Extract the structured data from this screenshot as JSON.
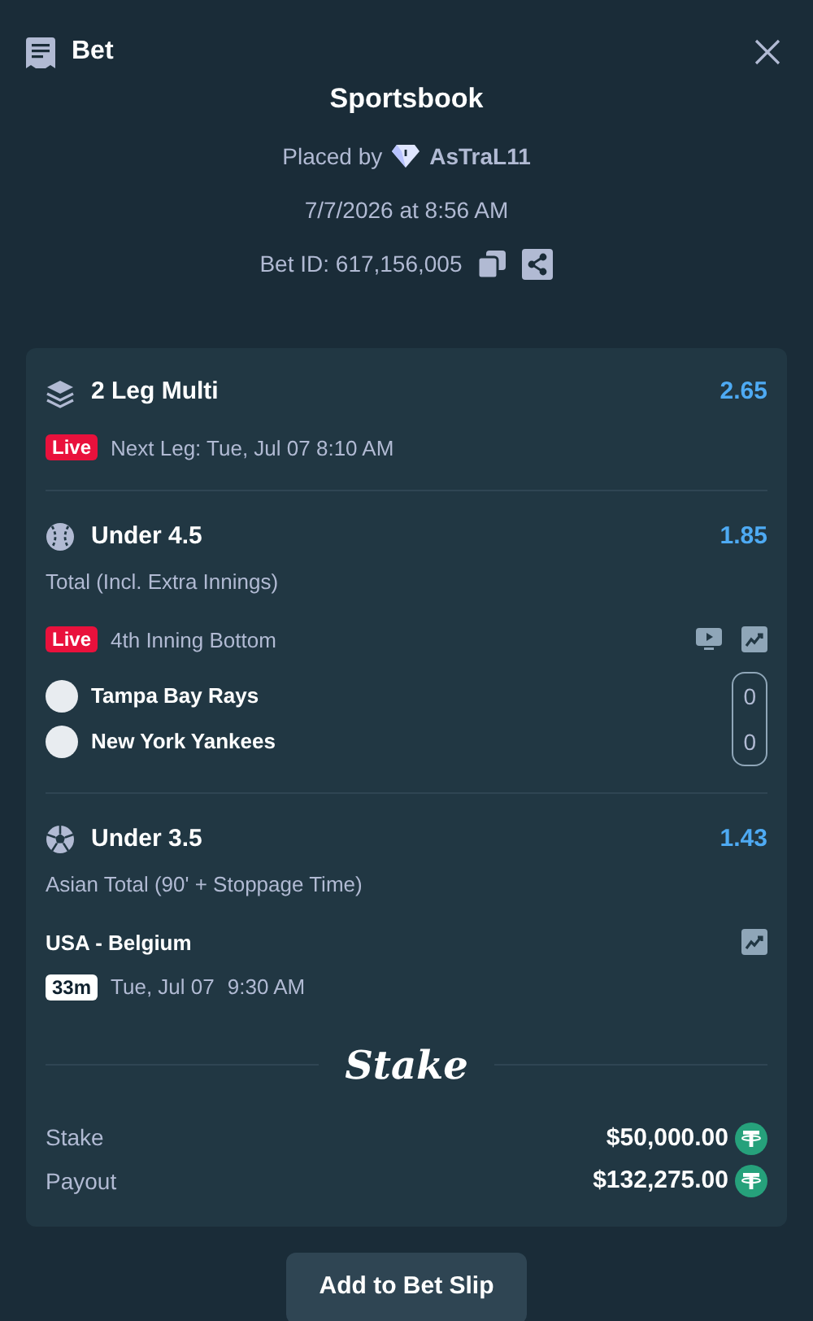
{
  "header": {
    "title": "Bet"
  },
  "summary": {
    "title": "Sportsbook",
    "placed_by_label": "Placed by",
    "user": "AsTraL11",
    "date": "7/7/2026 at 8:56 AM",
    "bet_id": "Bet ID: 617,156,005"
  },
  "multi": {
    "title": "2 Leg Multi",
    "odds": "2.65",
    "live_badge": "Live",
    "next_leg": "Next Leg: Tue, Jul 07 8:10 AM"
  },
  "legs": [
    {
      "kind": "baseball",
      "title": "Under 4.5",
      "odds": "1.85",
      "market": "Total (Incl. Extra Innings)",
      "live_badge": "Live",
      "status": "4th Inning Bottom",
      "teams": [
        {
          "name": "Tampa Bay Rays",
          "score": "0"
        },
        {
          "name": "New York Yankees",
          "score": "0"
        }
      ]
    },
    {
      "kind": "soccer",
      "title": "Under 3.5",
      "odds": "1.43",
      "market": "Asian Total (90' + Stoppage Time)",
      "event": "USA - Belgium",
      "countdown": "33m",
      "date": "Tue, Jul 07",
      "time": "9:30 AM"
    }
  ],
  "brand": "Stake",
  "totals": [
    {
      "label": "Stake",
      "value": "$50,000.00"
    },
    {
      "label": "Payout",
      "value": "$132,275.00"
    }
  ],
  "button": "Add to Bet Slip"
}
